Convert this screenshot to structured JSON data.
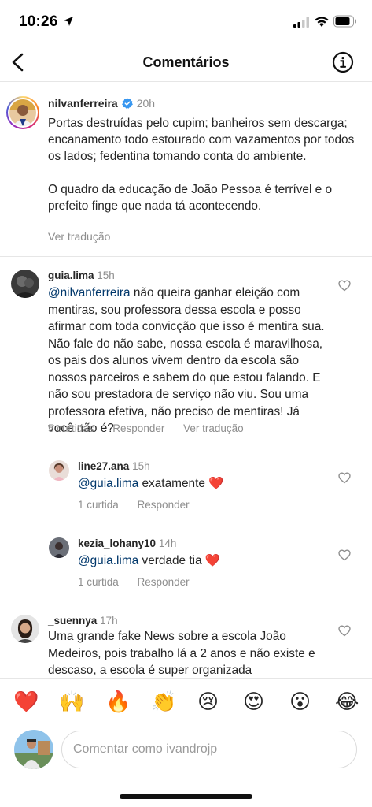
{
  "status": {
    "time": "10:26"
  },
  "header": {
    "title": "Comentários"
  },
  "caption": {
    "username": "nilvanferreira",
    "time": "20h",
    "paragraphs": [
      "Portas destruídas pelo cupim; banheiros sem descarga; encanamento todo estourado com vazamentos por todos os lados; fedentina tomando conta do ambiente.",
      "O quadro da educação de João Pessoa é terrível e o prefeito finge que nada tá acontecendo."
    ],
    "translate": "Ver tradução"
  },
  "comments": [
    {
      "username": "guia.lima",
      "time": "15h",
      "mention": "@nilvanferreira",
      "text": " não queira ganhar eleição com mentiras, sou professora dessa escola e posso afirmar com toda convicção que isso é mentira sua. Não fale do não sabe, nossa escola é maravilhosa, os pais dos alunos vivem dentro da escola são nossos parceiros e sabem do que estou falando. E não sou prestadora de serviço não viu. Sou uma professora efetiva, não preciso de mentiras! Já você não é?",
      "likes": "5 curtidas",
      "reply": "Responder",
      "translate": "Ver tradução"
    },
    {
      "username": "line27.ana",
      "time": "15h",
      "mention": "@guia.lima",
      "text": " exatamente ❤️",
      "likes": "1 curtida",
      "reply": "Responder"
    },
    {
      "username": "kezia_lohany10",
      "time": "14h",
      "mention": "@guia.lima",
      "text": " verdade tia ❤️",
      "likes": "1 curtida",
      "reply": "Responder"
    },
    {
      "username": "_suennya",
      "time": "17h",
      "text": "Uma grande fake News sobre a escola João Medeiros, pois trabalho lá a 2 anos e não existe e descaso, a escola é super organizada"
    }
  ],
  "emoji_bar": [
    "❤️",
    "🙌",
    "🔥",
    "👏",
    "😢",
    "😍",
    "😮",
    "😂"
  ],
  "composer": {
    "placeholder": "Comentar como ivandrojp"
  },
  "colors": {
    "mention": "#00376b",
    "verified": "#3897f0",
    "muted": "#8e8e8e"
  }
}
